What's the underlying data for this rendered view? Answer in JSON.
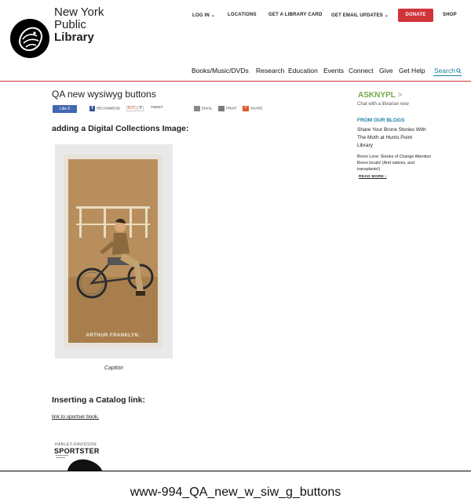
{
  "brand": {
    "line1": "New York",
    "line2": "Public",
    "line3": "Library"
  },
  "utility_nav": {
    "login": "LOG IN ⌄",
    "locations": "LOCATIONS",
    "library_card": "GET A LIBRARY CARD",
    "email_updates": "GET EMAIL UPDATES ⌄",
    "donate": "DONATE",
    "shop": "SHOP"
  },
  "main_nav": {
    "items": [
      "Books/Music/DVDs",
      "Research",
      "Education",
      "Events",
      "Connect",
      "Give",
      "Get Help"
    ],
    "search": "Search"
  },
  "page_title": "QA new wysiwyg buttons",
  "share": {
    "like": "Like 0",
    "recommend": "RECOMMEND",
    "gplus": "G+1",
    "gplus_count": "0",
    "tweet": "TWEET",
    "email": "EMAIL",
    "print": "PRINT",
    "share": "SHARE"
  },
  "dc_heading": "adding a Digital Collections Image:",
  "card_name": "ARTHUR FRANKLYN.",
  "caption": "Caption",
  "catalog_heading": "Inserting a Catalog link:",
  "catalog_link": "link to sportser book.",
  "book": {
    "small": "HARLEY-DAVIDSON",
    "big": "SPORTSTER"
  },
  "sidebar": {
    "ask_green": "ASK",
    "ask_green2": "NYPL",
    "ask_arrow": ">",
    "ask_sub": "Chat with a librarian now",
    "blogs_heading": "FROM OUR BLOGS",
    "blog1": "Share Your Bronx Stories With The Moth at Hunts Point Library",
    "blog2": "Bronx Love: Stories of Change Attention Bronx locals! (And natives, and transplants!)",
    "read_more": "READ MORE ›"
  },
  "file_caption": "www-994_QA_new_w_siw_g_buttons",
  "colors": {
    "nypl_red": "#d0343a",
    "link_blue": "#1b7fa0",
    "ask_green": "#71a844",
    "facebook": "#4267b2"
  }
}
